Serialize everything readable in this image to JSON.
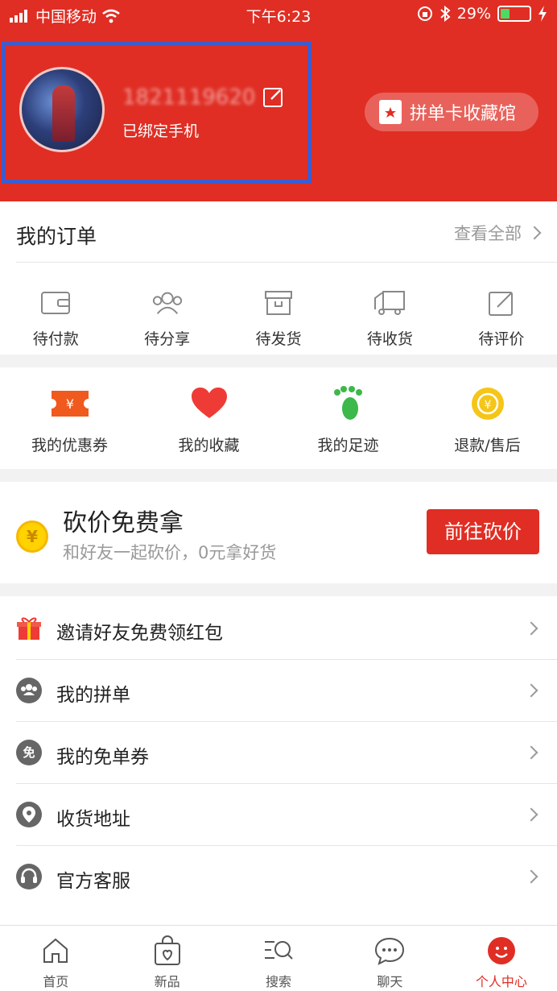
{
  "status_bar": {
    "carrier": "中国移动",
    "time": "下午6:23",
    "battery": "29%"
  },
  "profile": {
    "phone_masked": "1821119620",
    "phone_visible_tail": "0",
    "bound_label": "已绑定手机",
    "collection_button": "拼单卡收藏馆"
  },
  "orders": {
    "title": "我的订单",
    "view_all": "查看全部",
    "items": [
      {
        "label": "待付款",
        "icon": "wallet-icon"
      },
      {
        "label": "待分享",
        "icon": "group-icon"
      },
      {
        "label": "待发货",
        "icon": "box-icon"
      },
      {
        "label": "待收货",
        "icon": "truck-icon"
      },
      {
        "label": "待评价",
        "icon": "edit-icon"
      }
    ]
  },
  "shortcuts": [
    {
      "label": "我的优惠券",
      "icon": "coupon-icon",
      "color": "#f05a1e"
    },
    {
      "label": "我的收藏",
      "icon": "heart-icon",
      "color": "#ee3b36"
    },
    {
      "label": "我的足迹",
      "icon": "footprint-icon",
      "color": "#3db84a"
    },
    {
      "label": "退款/售后",
      "icon": "refund-icon",
      "color": "#f5c518"
    }
  ],
  "bargain": {
    "title": "砍价免费拿",
    "subtitle": "和好友一起砍价，0元拿好货",
    "button": "前往砍价",
    "coin_symbol": "¥"
  },
  "menu": [
    {
      "label": "邀请好友免费领红包",
      "icon": "gift-icon",
      "glyph": ""
    },
    {
      "label": "我的拼单",
      "icon": "group-order-icon",
      "glyph": ""
    },
    {
      "label": "我的免单券",
      "icon": "free-coupon-icon",
      "glyph": "免"
    },
    {
      "label": "收货地址",
      "icon": "location-icon",
      "glyph": ""
    },
    {
      "label": "官方客服",
      "icon": "headset-icon",
      "glyph": ""
    }
  ],
  "tabs": [
    {
      "label": "首页",
      "icon": "home-icon"
    },
    {
      "label": "新品",
      "icon": "shopping-bag-icon"
    },
    {
      "label": "搜索",
      "icon": "search-icon"
    },
    {
      "label": "聊天",
      "icon": "chat-icon"
    },
    {
      "label": "个人中心",
      "icon": "user-center-icon",
      "active": true
    }
  ],
  "colors": {
    "brand_red": "#e02e24",
    "highlight_border": "#3c5ccf"
  }
}
